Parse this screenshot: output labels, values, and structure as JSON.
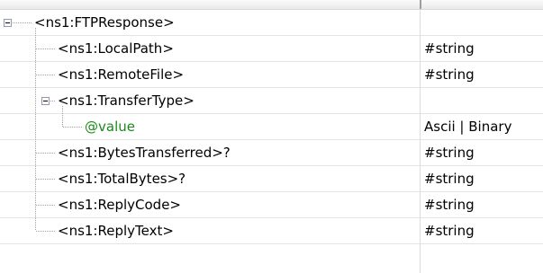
{
  "tree": {
    "rows": [
      {
        "label": "<ns1:FTPResponse>",
        "type": ""
      },
      {
        "label": "<ns1:LocalPath>",
        "type": "#string"
      },
      {
        "label": "<ns1:RemoteFile>",
        "type": "#string"
      },
      {
        "label": "<ns1:TransferType>",
        "type": ""
      },
      {
        "label": "@value",
        "type": "Ascii | Binary"
      },
      {
        "label": "<ns1:BytesTransferred>?",
        "type": "#string"
      },
      {
        "label": "<ns1:TotalBytes>?",
        "type": "#string"
      },
      {
        "label": "<ns1:ReplyCode>",
        "type": "#string"
      },
      {
        "label": "<ns1:ReplyText>",
        "type": "#string"
      }
    ]
  },
  "icons": {
    "collapse": "collapse-toggle-icon"
  },
  "colors": {
    "attribute_text": "#1a8a1a",
    "tree_line": "#a0a0a0",
    "row_separator": "#e4e4e4"
  }
}
